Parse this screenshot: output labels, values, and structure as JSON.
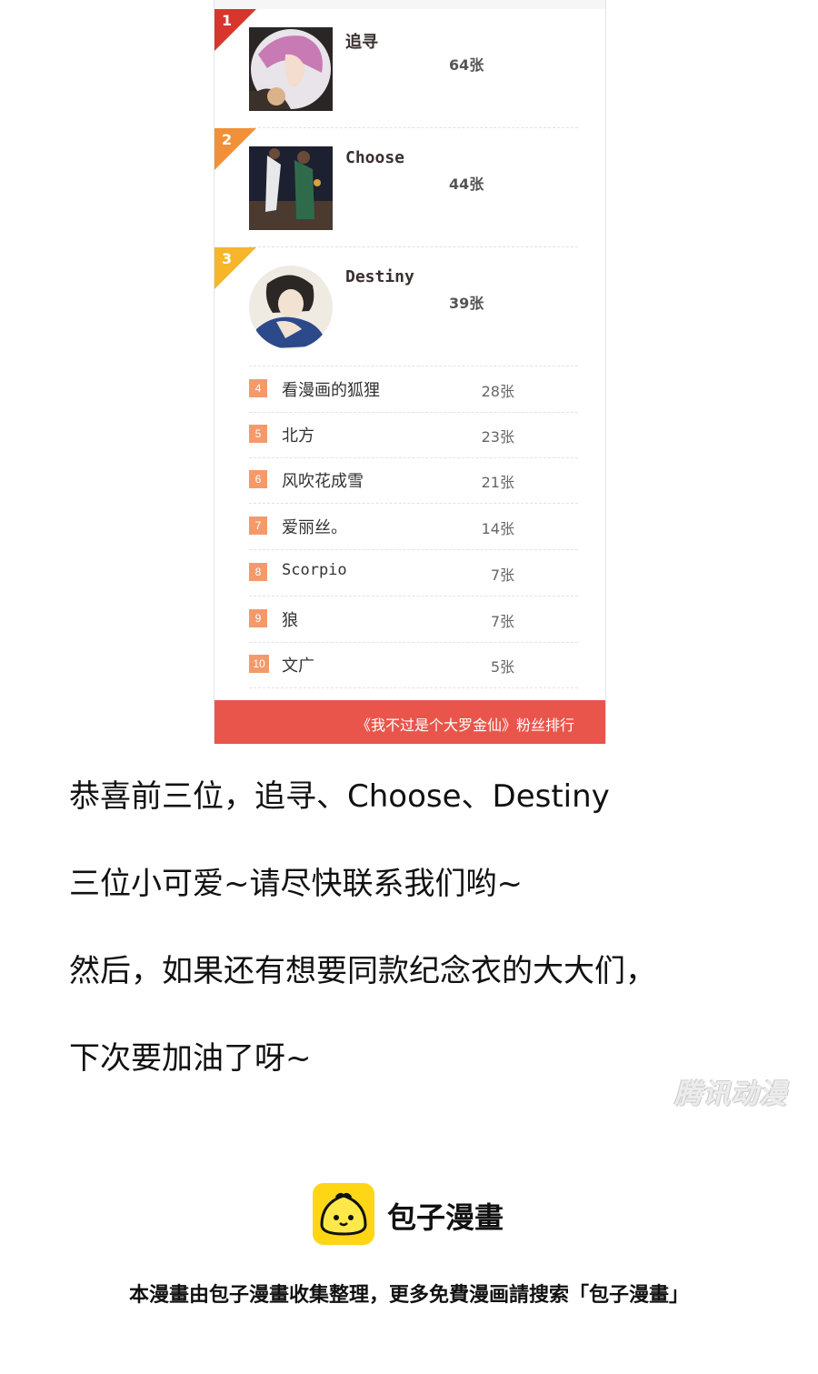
{
  "ranking": {
    "top": [
      {
        "rank": "1",
        "name": "追寻",
        "count": "64张"
      },
      {
        "rank": "2",
        "name": "Choose",
        "count": "44张"
      },
      {
        "rank": "3",
        "name": "Destiny",
        "count": "39张"
      }
    ],
    "list": [
      {
        "rank": "4",
        "name": "看漫画的狐狸",
        "count": "28张"
      },
      {
        "rank": "5",
        "name": "北方",
        "count": "23张"
      },
      {
        "rank": "6",
        "name": "风吹花成雪",
        "count": "21张"
      },
      {
        "rank": "7",
        "name": "爱丽丝。",
        "count": "14张"
      },
      {
        "rank": "8",
        "name": "Scorpio",
        "count": "7张"
      },
      {
        "rank": "9",
        "name": "狼",
        "count": "7张"
      },
      {
        "rank": "10",
        "name": "文广",
        "count": "5张"
      }
    ],
    "footer": "《我不过是个大罗金仙》粉丝排行",
    "colors": {
      "rank1": "#d8352d",
      "rank2": "#f0913a",
      "rank3": "#f7b52a",
      "badge": "#f39a6d",
      "footer": "#e9554b"
    }
  },
  "message": {
    "line1": "恭喜前三位，追寻、Choose、Destiny",
    "line2": "三位小可爱~请尽快联系我们哟~",
    "line3": "然后，如果还有想要同款纪念衣的大大们，",
    "line4": "下次要加油了呀~"
  },
  "watermark": "腾讯动漫",
  "brand": {
    "name": "包子漫畫",
    "logo_icon": "steamed-bun-icon"
  },
  "credit": "本漫畫由包子漫畫收集整理，更多免費漫画請搜索「包子漫畫」"
}
